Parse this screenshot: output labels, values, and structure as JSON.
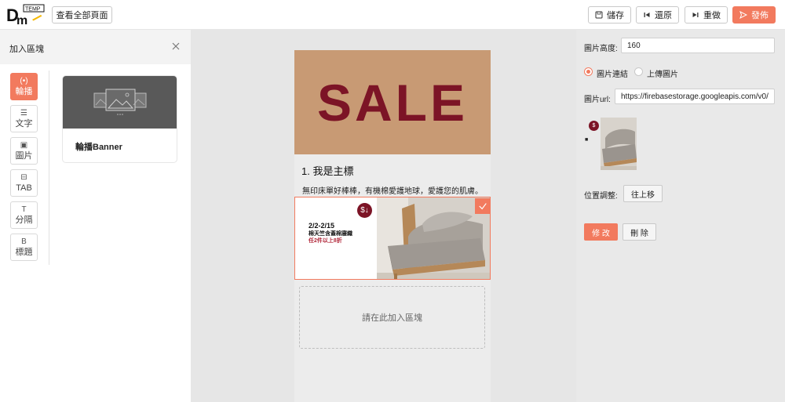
{
  "brand": {
    "logo_badge": "TEMP",
    "logo_text": "DM"
  },
  "toolbar": {
    "view_all": "查看全部頁面",
    "save": "儲存",
    "undo": "還原",
    "redo": "重做",
    "publish": "發佈"
  },
  "left_panel": {
    "title": "加入區塊",
    "categories": [
      {
        "icon": "(•)",
        "label": "輪播"
      },
      {
        "icon": "☰",
        "label": "文字"
      },
      {
        "icon": "▣",
        "label": "圖片"
      },
      {
        "icon": "⊟",
        "label": "TAB"
      },
      {
        "icon": "T",
        "label": "分隔"
      },
      {
        "icon": "B",
        "label": "標題"
      }
    ],
    "card_label": "輪播Banner"
  },
  "canvas": {
    "sale_text": "SALE",
    "heading": "1. 我是主標",
    "paragraph": "無印床單好棒棒，有機棉愛護地球，愛護您的肌膚。",
    "carousel": {
      "date": "2/2-2/15",
      "subtitle": "棉天竺含蓋棉寢織",
      "promo": "任2件以上8折"
    },
    "dropzone_text": "請在此加入區塊"
  },
  "right_panel": {
    "height_label": "圖片高度:",
    "height_value": "160",
    "radio_link": "圖片連結",
    "radio_upload": "上傳圖片",
    "url_label": "圖片url:",
    "url_value": "https://firebasestorage.googleapis.com/v0/",
    "position_label": "位置調整:",
    "move_up": "往上移",
    "modify": "修 改",
    "delete": "刪 除"
  },
  "colors": {
    "accent": "#f27a5e",
    "sale_red": "#7c1426",
    "banner_tan": "#c89a74"
  }
}
